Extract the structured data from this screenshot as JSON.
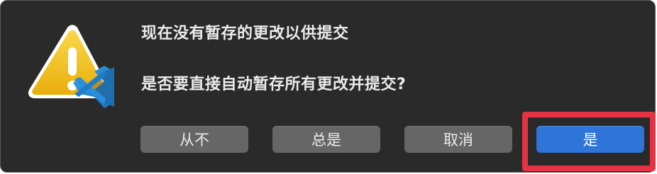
{
  "dialog": {
    "title": "现在没有暂存的更改以供提交",
    "message": "是否要直接自动暂存所有更改并提交?",
    "icon": "vscode-warning-icon"
  },
  "buttons": [
    {
      "label": "从不"
    },
    {
      "label": "总是"
    },
    {
      "label": "取消"
    },
    {
      "label": "是",
      "primary": true
    }
  ],
  "colors": {
    "dialog_bg": "#2b2a2a",
    "button_bg": "#666666",
    "primary_button_bg": "#2f74d9",
    "highlight": "#e53343",
    "warning_yellow": "#f2c414",
    "vscode_blue": "#2489ca"
  }
}
